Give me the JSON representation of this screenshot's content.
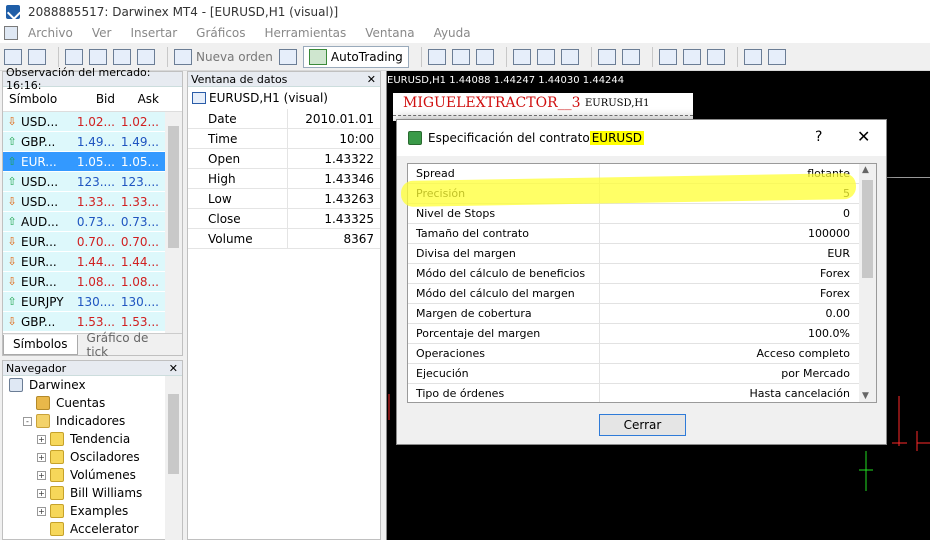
{
  "window": {
    "title": "2088885517: Darwinex MT4 - [EURUSD,H1 (visual)]"
  },
  "menu": [
    "Archivo",
    "Ver",
    "Insertar",
    "Gráficos",
    "Herramientas",
    "Ventana",
    "Ayuda"
  ],
  "toolbar": {
    "new_order": "Nueva orden",
    "autotrading": "AutoTrading"
  },
  "market_watch": {
    "title": "Observación del mercado: 16:16:",
    "columns": [
      "Símbolo",
      "Bid",
      "Ask"
    ],
    "rows": [
      {
        "dir": "down",
        "symbol": "USD...",
        "bid": "1.02...",
        "ask": "1.02..."
      },
      {
        "dir": "up",
        "symbol": "GBP...",
        "bid": "1.49...",
        "ask": "1.49..."
      },
      {
        "dir": "up",
        "symbol": "EUR...",
        "bid": "1.05...",
        "ask": "1.05...",
        "selected": true
      },
      {
        "dir": "up",
        "symbol": "USD...",
        "bid": "123....",
        "ask": "123...."
      },
      {
        "dir": "down",
        "symbol": "USD...",
        "bid": "1.33...",
        "ask": "1.33..."
      },
      {
        "dir": "up",
        "symbol": "AUD...",
        "bid": "0.73...",
        "ask": "0.73..."
      },
      {
        "dir": "down",
        "symbol": "EUR...",
        "bid": "0.70...",
        "ask": "0.70..."
      },
      {
        "dir": "down",
        "symbol": "EUR...",
        "bid": "1.44...",
        "ask": "1.44..."
      },
      {
        "dir": "down",
        "symbol": "EUR...",
        "bid": "1.08...",
        "ask": "1.08..."
      },
      {
        "dir": "up",
        "symbol": "EURJPY",
        "bid": "130....",
        "ask": "130...."
      },
      {
        "dir": "down",
        "symbol": "GBP...",
        "bid": "1.53...",
        "ask": "1.53..."
      }
    ],
    "tabs": [
      "Símbolos",
      "Gráfico de tick"
    ]
  },
  "navigator": {
    "title": "Navegador",
    "items": [
      {
        "label": "Darwinex",
        "level": 0,
        "icon": "root"
      },
      {
        "label": "Cuentas",
        "level": 1,
        "icon": "people"
      },
      {
        "label": "Indicadores",
        "level": 1,
        "icon": "folder",
        "expander": "-"
      },
      {
        "label": "Tendencia",
        "level": 2,
        "icon": "indicator",
        "expander": "+"
      },
      {
        "label": "Osciladores",
        "level": 2,
        "icon": "indicator",
        "expander": "+"
      },
      {
        "label": "Volúmenes",
        "level": 2,
        "icon": "indicator",
        "expander": "+"
      },
      {
        "label": "Bill Williams",
        "level": 2,
        "icon": "indicator",
        "expander": "+"
      },
      {
        "label": "Examples",
        "level": 2,
        "icon": "indicator",
        "expander": "+"
      },
      {
        "label": "Accelerator",
        "level": 2,
        "icon": "indicator"
      }
    ]
  },
  "data_window": {
    "title": "Ventana de datos",
    "header": "EURUSD,H1 (visual)",
    "rows": [
      {
        "k": "Date",
        "v": "2010.01.01"
      },
      {
        "k": "Time",
        "v": "10:00"
      },
      {
        "k": "Open",
        "v": "1.43322"
      },
      {
        "k": "High",
        "v": "1.43346"
      },
      {
        "k": "Low",
        "v": "1.43263"
      },
      {
        "k": "Close",
        "v": "1.43325"
      },
      {
        "k": "Volume",
        "v": "8367"
      }
    ]
  },
  "chart": {
    "header": "EURUSD,H1  1.44088 1.44247 1.44030 1.44244",
    "label_big": "MIGUELEXTRACTOR__3",
    "label_small": "EURUSD,H1"
  },
  "dialog": {
    "title_prefix": "Especificación del contrato ",
    "title_symbol": "EURUSD",
    "help": "?",
    "close": "✕",
    "rows": [
      {
        "k": "Spread",
        "v": "flotante"
      },
      {
        "k": "Precisión",
        "v": "5"
      },
      {
        "k": "Nivel de Stops",
        "v": "0"
      },
      {
        "k": "Tamaño del contrato",
        "v": "100000"
      },
      {
        "k": "Divisa del margen",
        "v": "EUR"
      },
      {
        "k": "Módo del cálculo de beneficios",
        "v": "Forex"
      },
      {
        "k": "Módo del cálculo del margen",
        "v": "Forex"
      },
      {
        "k": "Margen de cobertura",
        "v": "0.00"
      },
      {
        "k": "Porcentaje del margen",
        "v": "100.0%"
      },
      {
        "k": "Operaciones",
        "v": "Acceso completo"
      },
      {
        "k": "Ejecución",
        "v": "por Mercado"
      },
      {
        "k": "Tipo de órdenes",
        "v": "Hasta cancelación"
      }
    ],
    "button": "Cerrar"
  },
  "colors": {
    "highlight": "#ffff00",
    "selection": "#3399ff",
    "up_arrow": "#1aa34a",
    "down_arrow": "#e05a00"
  }
}
